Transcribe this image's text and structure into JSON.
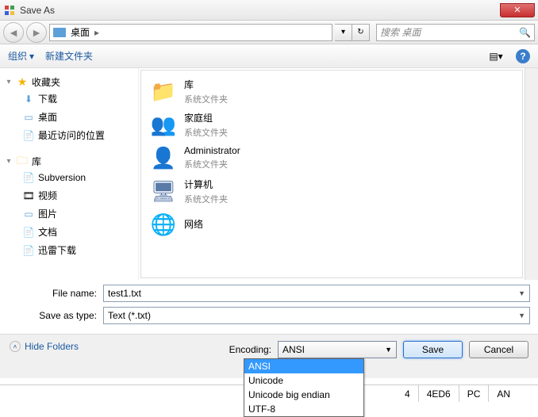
{
  "title": "Save As",
  "close_icon": "✕",
  "nav": {
    "back": "◄",
    "fwd": "►"
  },
  "address": {
    "location": "桌面",
    "sep": "▸"
  },
  "search": {
    "placeholder": "搜索 桌面",
    "icon": "🔍"
  },
  "toolbar": {
    "organize": "组织",
    "caret": "▾",
    "newfolder": "新建文件夹",
    "view": "▤▾",
    "help": "?"
  },
  "sidebar": {
    "fav": {
      "label": "收藏夹",
      "items": [
        "下载",
        "桌面",
        "最近访问的位置"
      ]
    },
    "lib": {
      "label": "库",
      "items": [
        "Subversion",
        "视频",
        "图片",
        "文档",
        "迅雷下载"
      ]
    }
  },
  "main": [
    {
      "name": "库",
      "sub": "系统文件夹",
      "icon": "📁",
      "color": "#f3c24a"
    },
    {
      "name": "家庭组",
      "sub": "系统文件夹",
      "icon": "👥",
      "color": "#3a8fc7"
    },
    {
      "name": "Administrator",
      "sub": "系统文件夹",
      "icon": "👤",
      "color": "#70a040"
    },
    {
      "name": "计算机",
      "sub": "系统文件夹",
      "icon": "🖥",
      "color": "#5a7aa8"
    },
    {
      "name": "网络",
      "sub": "",
      "icon": "🌐",
      "color": "#3a8fc7"
    }
  ],
  "form": {
    "filename_label": "File name:",
    "filename_value": "test1.txt",
    "type_label": "Save as type:",
    "type_value": "Text (*.txt)"
  },
  "bottom": {
    "hide_folders": "Hide Folders",
    "encoding_label": "Encoding:",
    "encoding_value": "ANSI",
    "save": "Save",
    "cancel": "Cancel"
  },
  "encoding_options": [
    "ANSI",
    "Unicode",
    "Unicode big endian",
    "UTF-8"
  ],
  "behind_row": {
    "c1": "4",
    "c2": "4ED6",
    "c3": "PC",
    "c4": "AN"
  }
}
